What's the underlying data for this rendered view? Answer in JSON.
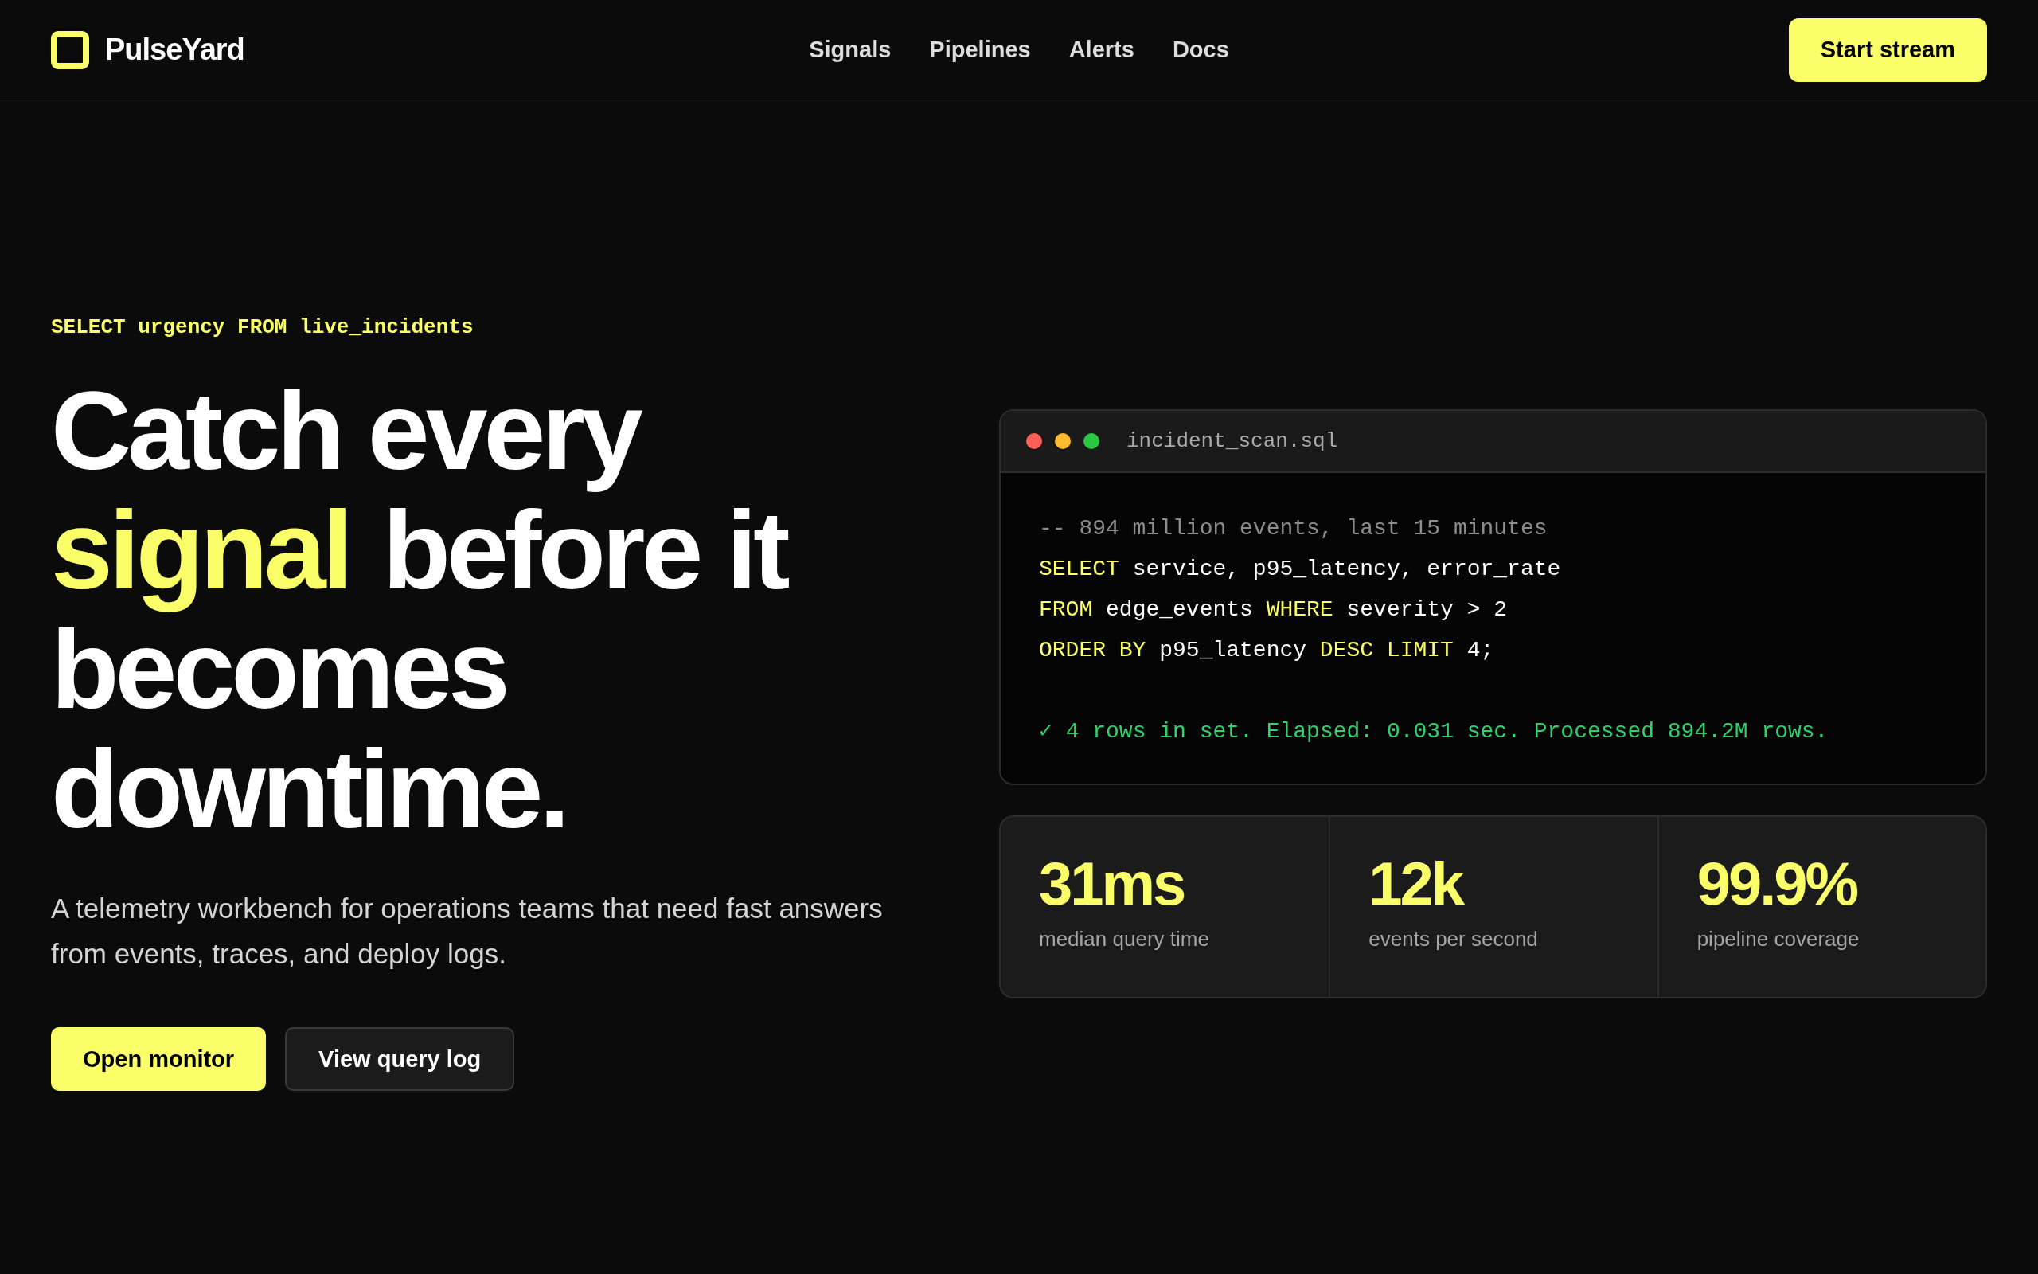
{
  "brand": {
    "name": "PulseYard"
  },
  "nav": [
    {
      "label": "Signals"
    },
    {
      "label": "Pipelines"
    },
    {
      "label": "Alerts"
    },
    {
      "label": "Docs"
    }
  ],
  "header_button": "Start stream",
  "hero": {
    "eyebrow": "SELECT urgency FROM live_incidents",
    "headline": [
      {
        "text": "Catch every",
        "highlight": false
      },
      {
        "text": "signal",
        "highlight": true
      },
      {
        "text": "before it becomes downtime.",
        "highlight": false
      }
    ],
    "lead": "A telemetry workbench for operations teams that need fast answers from events, traces, and deploy logs.",
    "buttons": [
      {
        "label": "Open monitor",
        "kind": "primary"
      },
      {
        "label": "View query log",
        "kind": "secondary"
      }
    ]
  },
  "editor": {
    "filename": "incident_scan.sql",
    "dots": [
      {
        "color": "#ff5f57"
      },
      {
        "color": "#febc2e"
      },
      {
        "color": "#28c840"
      }
    ],
    "lines": [
      {
        "kind": "code",
        "tokens": [
          {
            "kind": "comment",
            "text": "-- 894 million events, last 15 minutes"
          }
        ]
      },
      {
        "kind": "code",
        "tokens": [
          {
            "kind": "keyword",
            "text": "SELECT"
          },
          {
            "kind": "plain",
            "text": " service, p95_latency, error_rate"
          }
        ]
      },
      {
        "kind": "code",
        "tokens": [
          {
            "kind": "keyword",
            "text": "FROM"
          },
          {
            "kind": "plain",
            "text": " edge_events "
          },
          {
            "kind": "keyword",
            "text": "WHERE"
          },
          {
            "kind": "plain",
            "text": " severity > 2"
          }
        ]
      },
      {
        "kind": "code",
        "tokens": [
          {
            "kind": "keyword",
            "text": "ORDER BY"
          },
          {
            "kind": "plain",
            "text": " p95_latency "
          },
          {
            "kind": "keyword",
            "text": "DESC LIMIT"
          },
          {
            "kind": "plain",
            "text": " 4;"
          }
        ]
      },
      {
        "kind": "result",
        "tokens": [
          {
            "kind": "success",
            "text": "✓ 4 rows in set. Elapsed: 0.031 sec. Processed 894.2M rows."
          }
        ]
      }
    ]
  },
  "stats": [
    {
      "value": "31ms",
      "label": "median query time"
    },
    {
      "value": "12k",
      "label": "events per second"
    },
    {
      "value": "99.9%",
      "label": "pipeline coverage"
    }
  ]
}
